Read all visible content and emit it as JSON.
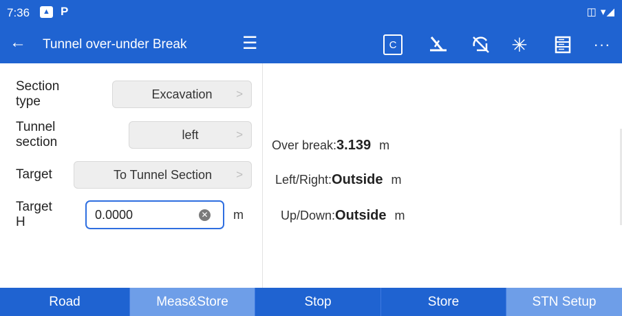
{
  "status_bar": {
    "time": "7:36",
    "icons": [
      "gallery-icon",
      "parking-p-icon",
      "cast-icon",
      "wifi-icon",
      "signal-icon"
    ]
  },
  "app_bar": {
    "title": "Tunnel over-under Break",
    "c_label": "C",
    "icons": [
      "back-arrow-icon",
      "hamburger-menu-icon",
      "c-box-icon",
      "survey-pole-icon",
      "no-signal-icon",
      "laser-star-icon",
      "storage-list-icon",
      "more-dots-icon"
    ],
    "color": "#1f63d1"
  },
  "form": {
    "section_type": {
      "label": "Section type",
      "value": "Excavation"
    },
    "tunnel_section": {
      "label": "Tunnel section",
      "value": "left"
    },
    "target": {
      "label": "Target",
      "value": "To Tunnel Section"
    },
    "target_h": {
      "label": "Target H",
      "value": "0.0000",
      "unit": "m"
    }
  },
  "results": {
    "over_break": {
      "label": "Over break:",
      "value": "3.139",
      "unit": "m"
    },
    "left_right": {
      "label": "Left/Right:",
      "value": "Outside",
      "unit": "m"
    },
    "up_down": {
      "label": "Up/Down:",
      "value": "Outside",
      "unit": "m"
    }
  },
  "tabs": [
    {
      "label": "Road",
      "highlight": false
    },
    {
      "label": "Meas&Store",
      "highlight": true
    },
    {
      "label": "Stop",
      "highlight": false
    },
    {
      "label": "Store",
      "highlight": false
    },
    {
      "label": "STN Setup",
      "highlight": true
    }
  ],
  "colors": {
    "primary": "#1f63d1",
    "tab_light": "#6e9ee8",
    "input_border": "#2e6ee0"
  }
}
